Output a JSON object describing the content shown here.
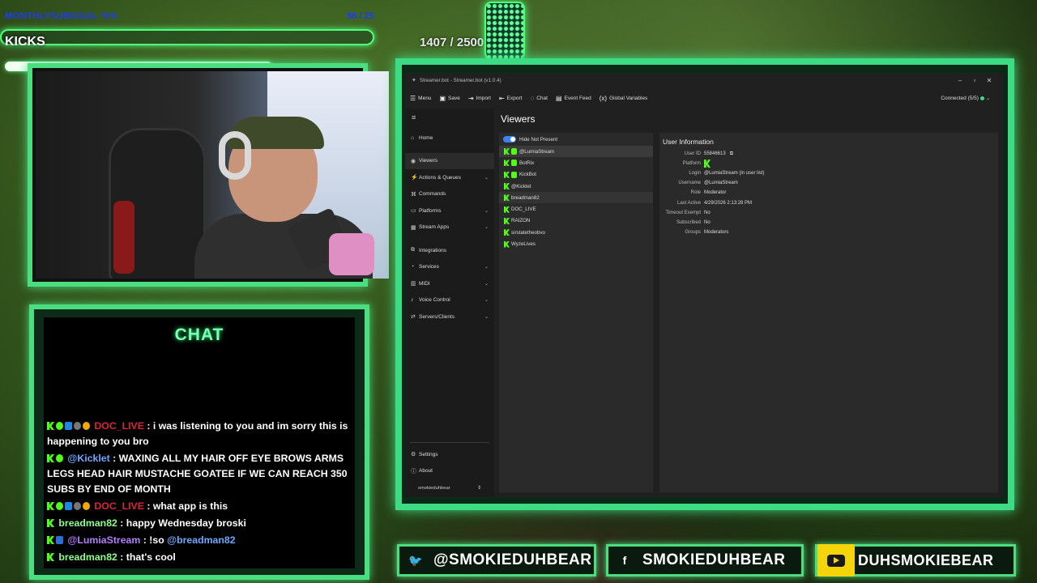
{
  "overlay": {
    "goal_label": "MONTHLYSUBGOAL %%",
    "goal_count": "98 / 25",
    "kicks_label": "KICKS",
    "sub_count": "1407 / 2500"
  },
  "chat": {
    "title": "CHAT",
    "messages": [
      {
        "user": "DOC_LIVE",
        "text": ": i was listening to you and im sorry this is happening to you bro"
      },
      {
        "user": "@Kicklet",
        "text": ": WAXING ALL MY HAIR OFF EYE BROWS ARMS LEGS HEAD HAIR MUSTACHE GOATEE IF WE CAN REACH 350 SUBS BY END OF MONTH"
      },
      {
        "user": "DOC_LIVE",
        "text": ": what app is this"
      },
      {
        "user": "breadman82",
        "text": ": happy Wednesday broski"
      },
      {
        "user": "@LumiaStream",
        "text": ": !so",
        "mention": "@breadman82"
      },
      {
        "user": "breadman82",
        "text": ": that's cool"
      }
    ]
  },
  "app": {
    "window_title": "Streamer.bot - Streamer.bot (v1.0.4)",
    "toolbar": {
      "menu": "Menu",
      "save": "Save",
      "import": "Import",
      "export": "Export",
      "chat": "Chat",
      "event_feed": "Event Feed",
      "global_variables": "Global Variables",
      "connected": "Connected (5/5)"
    },
    "sidebar": {
      "items": [
        {
          "label": "Home"
        },
        {
          "label": "Viewers"
        },
        {
          "label": "Actions & Queues"
        },
        {
          "label": "Commands"
        },
        {
          "label": "Platforms"
        },
        {
          "label": "Stream Apps"
        },
        {
          "label": "Integrations"
        },
        {
          "label": "Services"
        },
        {
          "label": "MIDI"
        },
        {
          "label": "Voice Control"
        },
        {
          "label": "Servers/Clients"
        }
      ],
      "settings": "Settings",
      "about": "About",
      "account": "smokieduhbear"
    },
    "viewers": {
      "title": "Viewers",
      "hide_not_present": "Hide Not Present",
      "list": [
        "@LumiaStream",
        "BotRix",
        "KickBot",
        "@Kicklet",
        "breadman82",
        "DOC_LIVE",
        "RAIZON",
        "sirstatetheobvo",
        "WyzeLives"
      ]
    },
    "user_info": {
      "title": "User Information",
      "labels": {
        "user_id": "User ID",
        "platform": "Platform",
        "login": "Login",
        "username": "Username",
        "role": "Role",
        "last_active": "Last Active",
        "timeout_exempt": "Timeout Exempt",
        "subscribed": "Subscribed",
        "groups": "Groups"
      },
      "values": {
        "user_id": "55846613",
        "login": "@LumiaStream (in user list)",
        "username": "@LumiaStream",
        "role": "Moderator",
        "last_active": "4/29/2026 2:13:28 PM",
        "timeout_exempt": "No",
        "subscribed": "No",
        "groups": "Moderators"
      }
    }
  },
  "socials": {
    "twitter": "@SMOKIEDUHBEAR",
    "facebook": "SMOKIEDUHBEAR",
    "youtube": "DUHSMOKIEBEAR"
  },
  "colors": {
    "accent": "#4ade80",
    "kick_green": "#53fc18",
    "chat_title": "#7dffb3",
    "user_red": "#d9243a",
    "user_blue": "#6ea8ff",
    "user_green": "#8dff8d",
    "user_purple": "#b47cff"
  }
}
